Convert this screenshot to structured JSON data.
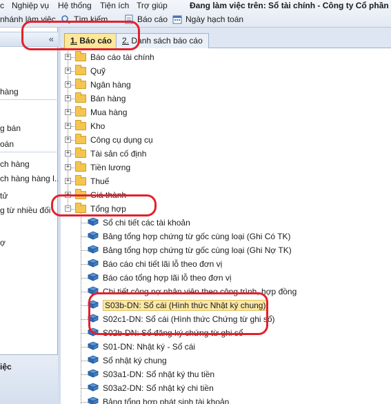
{
  "menubar": {
    "items": [
      "c",
      "Nghiệp vụ",
      "Hệ thống",
      "Tiện ích",
      "Trợ giúp"
    ],
    "title": "Đang làm việc trên: Sổ tài chính - Công ty Cổ phần A"
  },
  "toolbar": {
    "branch_label": "nhánh làm việc",
    "search_label": "Tìm kiếm",
    "report_label": "Báo cáo",
    "date_label": "Ngày hạch toán"
  },
  "left_panel": {
    "collapse_glyph": "«",
    "items": [
      "hàng",
      "g bán",
      "oán",
      "ch hàng",
      "ch hàng hàng l...",
      "tử",
      "g từ nhiều đối",
      "ợ"
    ],
    "footer_label": "iệc"
  },
  "tabs": [
    {
      "number": "1.",
      "label": "Báo cáo",
      "active": true
    },
    {
      "number": "2.",
      "label": "Danh sách báo cáo",
      "active": false
    }
  ],
  "tree": {
    "folders": [
      "Báo cáo tài chính",
      "Quỹ",
      "Ngân hàng",
      "Bán hàng",
      "Mua hàng",
      "Kho",
      "Công cụ dụng cụ",
      "Tài sản cố định",
      "Tiền lương",
      "Thuế",
      "Giá thành",
      "Tổng hợp"
    ],
    "reports": [
      "Sổ chi tiết các tài khoản",
      "Bảng tổng hợp chứng từ gốc cùng loại (Ghi Có TK)",
      "Bảng tổng hợp chứng từ gốc cùng loại (Ghi Nợ TK)",
      "Báo cáo chi tiết lãi lỗ theo đơn vị",
      "Báo cáo tổng hợp lãi lỗ theo đơn vị",
      "Chi tiết công nợ nhân viên theo công trình, hợp đồng",
      "S03b-DN: Sổ cái (Hình thức Nhật ký chung)",
      "S02c1-DN: Sổ cái (Hình thức Chứng từ ghi sổ)",
      "S02b-DN: Sổ đăng ký chứng từ ghi sổ",
      "S01-DN: Nhật ký - Sổ cái",
      "Sổ nhật ký chung",
      "S03a1-DN: Sổ nhật ký thu tiền",
      "S03a2-DN: Sổ nhật ký chi tiền",
      "Bảng tổng hợp phát sinh tài khoản"
    ],
    "selected_report": "S03b-DN: Sổ cái (Hình thức Nhật ký chung)"
  },
  "colors": {
    "annotation": "#e3202c",
    "active_tab": "#fde79a",
    "folder": "#f4c650",
    "book": "#2f6db5"
  }
}
